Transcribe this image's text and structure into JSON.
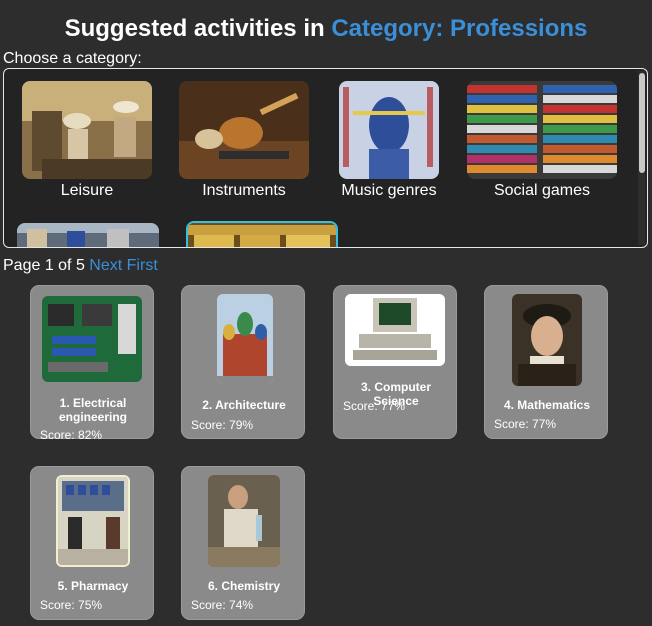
{
  "header": {
    "title_prefix": "Suggested activities in",
    "title_category": "Category: Professions"
  },
  "categories": {
    "prompt": "Choose a category:",
    "items": [
      {
        "label": "Leisure",
        "icon": "leisure-photo"
      },
      {
        "label": "Instruments",
        "icon": "instruments-photo"
      },
      {
        "label": "Music genres",
        "icon": "music-genres-photo"
      },
      {
        "label": "Social games",
        "icon": "social-games-photo"
      },
      {
        "label": "",
        "icon": "sports-photo"
      },
      {
        "label": "",
        "icon": "professions-photo"
      }
    ]
  },
  "pagination": {
    "status": "Page 1 of 5",
    "next": "Next",
    "first": "First"
  },
  "activities": [
    {
      "name": "1. Electrical engineering",
      "score": "Score: 82%",
      "icon": "circuit-board-photo"
    },
    {
      "name": "2. Architecture",
      "score": "Score: 79%",
      "icon": "cathedral-photo"
    },
    {
      "name": "3. Computer Science",
      "score": "Score: 77%",
      "icon": "computer-photo"
    },
    {
      "name": "4. Mathematics",
      "score": "Score: 77%",
      "icon": "mathematician-portrait"
    },
    {
      "name": "5. Pharmacy",
      "score": "Score: 75%",
      "icon": "pharmacy-photo"
    },
    {
      "name": "6. Chemistry",
      "score": "Score: 74%",
      "icon": "chemist-photo"
    }
  ]
}
